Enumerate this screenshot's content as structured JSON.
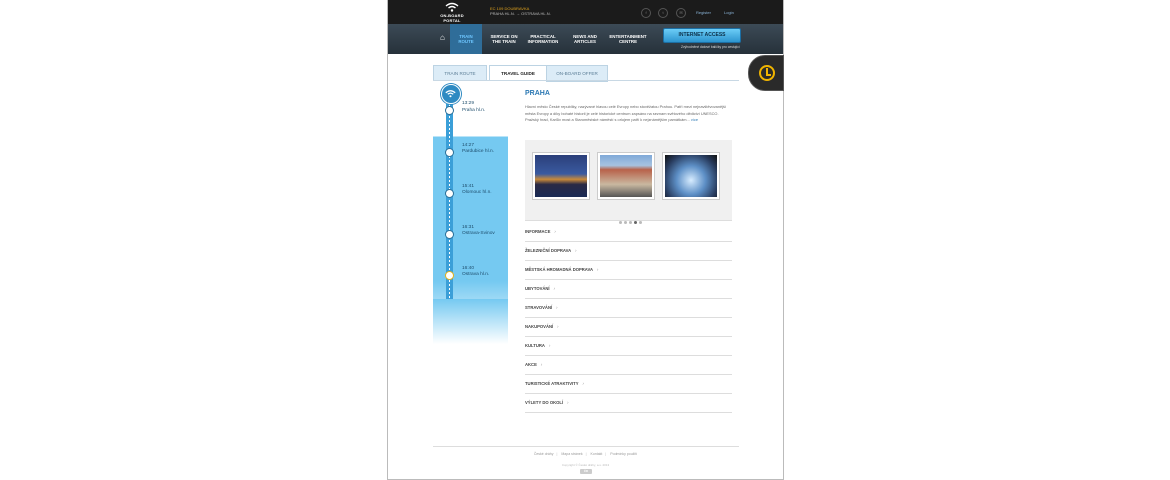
{
  "header": {
    "logo_text": "ON-BOARD PORTAL",
    "train_number": "EC 109 DOUBRAVKA",
    "train_route": "PRAHA HL.N. → OSTRAVA HL.N.",
    "register_label": "Register",
    "login_label": "Login"
  },
  "nav": {
    "home_icon": "home-icon",
    "items": [
      {
        "label": "TRAIN ROUTE",
        "active": true
      },
      {
        "label": "SERVICE ON THE TRAIN",
        "active": false
      },
      {
        "label": "PRACTICAL INFORMATION",
        "active": false
      },
      {
        "label": "NEWS AND ARTICLES",
        "active": false
      },
      {
        "label": "ENTERTAINMENT CENTRE",
        "active": false
      }
    ],
    "internet_button": "INTERNET ACCESS",
    "internet_sub": "Zvýhodněné datové balíčky pro cestující"
  },
  "tabs": [
    {
      "label": "TRAIN ROUTE",
      "active": false
    },
    {
      "label": "TRAVEL GUIDE",
      "active": true
    },
    {
      "label": "ON-BOARD OFFER",
      "active": false
    }
  ],
  "timeline": {
    "stops": [
      {
        "time": "13:29",
        "name": "Praha hl.n."
      },
      {
        "time": "14:27",
        "name": "Pardubice hl.n."
      },
      {
        "time": "15:41",
        "name": "Olomouc hl.n."
      },
      {
        "time": "16:31",
        "name": "Ostrava-Svinov"
      },
      {
        "time": "16:40",
        "name": "Ostrava hl.n."
      }
    ]
  },
  "guide": {
    "city": "PRAHA",
    "description": "Hlavní město České republiky, nazývané hlavou celé Evropy nebo stověžatou Prahou. Patří mezi nejnavštěvovanější města Evropy a díky bohaté historii je celé historické centrum zapsáno na seznam světového dědictví UNESCO. Pražský hrad, Karlův most a Staroměstské náměstí s orlojem patří k nejznámějším památkám...",
    "more_label": "více",
    "photos_alt": [
      "Pražský hrad v noci",
      "Tančící dům",
      "Prosklená kupole"
    ],
    "categories": [
      "INFORMACE",
      "ŽELEZNIČNÍ DOPRAVA",
      "MĚSTSKÁ HROMADNÁ DOPRAVA",
      "UBYTOVÁNÍ",
      "STRAVOVÁNÍ",
      "NAKUPOVÁNÍ",
      "KULTURA",
      "AKCE",
      "TURISTICKÉ ATRAKTIVITY",
      "VÝLETY DO OKOLÍ"
    ]
  },
  "footer": {
    "links": [
      "České dráhy",
      "Mapa stránek",
      "Kontakt",
      "Podmínky použití"
    ],
    "copyright": "Copyright © České dráhy, a.s. 2013"
  },
  "colors": {
    "accent": "#2b78b3",
    "timeline": "#75c9f1",
    "topbar": "#1b1b1b",
    "clock": "#f0b400"
  }
}
